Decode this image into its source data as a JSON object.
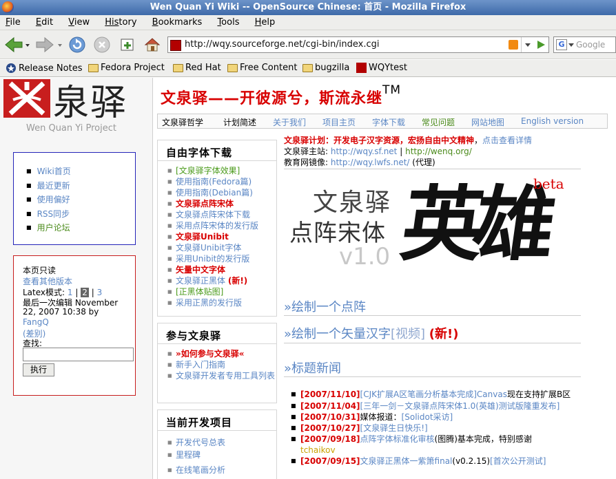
{
  "window": {
    "title": "Wen Quan Yi Wiki -- OpenSource Chinese: 首页 - Mozilla Firefox"
  },
  "menu": [
    {
      "key": "F",
      "rest": "ile"
    },
    {
      "key": "E",
      "rest": "dit"
    },
    {
      "key": "V",
      "rest": "iew"
    },
    {
      "key": "His",
      "rest": "tory"
    },
    {
      "key": "B",
      "rest": "ookmarks"
    },
    {
      "key": "T",
      "rest": "ools"
    },
    {
      "key": "H",
      "rest": "elp"
    }
  ],
  "nav": {
    "url": "http://wqy.sourceforge.net/cgi-bin/index.cgi",
    "search_placeholder": "Google",
    "search_engine_glyph": "G"
  },
  "bookmarks": [
    "Release Notes",
    "Fedora Project",
    "Red Hat",
    "Free Content",
    "bugzilla",
    "WQYtest"
  ],
  "logo": {
    "text": "泉驿",
    "subtitle": "Wen Quan Yi Project"
  },
  "sidebar_nav": [
    "Wiki首页",
    "最近更新",
    "使用偏好",
    "RSS同步",
    "用户论坛"
  ],
  "toolbox": {
    "this_page": "本页只读",
    "other_versions": "查看其他版本",
    "latex_label": "Latex模式:",
    "latex_1": "1",
    "latex_sep1": "|",
    "latex_2": "2",
    "latex_sep2": "|",
    "latex_3": "3",
    "last_edit_1": "最后一次编辑 November",
    "last_edit_2": "22, 2007 10:38 by",
    "author": "FangQ",
    "diff": "(差别)",
    "search_label": "查找:",
    "search_button": "执行"
  },
  "header": {
    "title": "文泉驿——开彼源兮，斯流永继",
    "tm": "TM"
  },
  "tabs": [
    "文泉驿哲学",
    "计划简述",
    "关于我们",
    "项目主页",
    "字体下载",
    "常见问题",
    "网站地图",
    "English version"
  ],
  "panels": {
    "fonts": {
      "title": "自由字体下载",
      "items": [
        {
          "text": "[文泉驿字体效果]",
          "style": "green"
        },
        {
          "text": "使用指南(Fedora篇)",
          "style": "link"
        },
        {
          "text": "使用指南(Debian篇)",
          "style": "link"
        },
        {
          "text": "文泉驿点阵宋体",
          "style": "red"
        },
        {
          "text": "文泉驿点阵宋体下载",
          "style": "link"
        },
        {
          "text": "采用点阵宋体的发行版",
          "style": "link"
        },
        {
          "text": "文泉驿Unibit",
          "style": "red"
        },
        {
          "text": "文泉驿Unibit字体",
          "style": "link"
        },
        {
          "text": "采用Unibit的发行版",
          "style": "link"
        },
        {
          "text": "矢量中文字体",
          "style": "red"
        },
        {
          "text": "文泉驿正黑体",
          "style": "link"
        },
        {
          "text": "(新!)",
          "style": "red"
        },
        {
          "text": "[正黑体贴图]",
          "style": "green"
        },
        {
          "text": "采用正黑的发行版",
          "style": "link"
        }
      ]
    },
    "join": {
      "title": "参与文泉驿",
      "items": [
        {
          "text": "»如何参与文泉驿«",
          "style": "red"
        },
        {
          "text": "新手入门指南",
          "style": "link"
        },
        {
          "text": "文泉驿开发者专用工具列表",
          "style": "link"
        }
      ]
    },
    "projects": {
      "title": "当前开发项目",
      "items": [
        {
          "text": "开发代号总表",
          "style": "link"
        },
        {
          "text": "里程碑",
          "style": "link"
        },
        {
          "text": "在线笔画分析",
          "style": "link"
        }
      ]
    }
  },
  "main": {
    "plan_label": "文泉驿计划：开发电子汉字资源，宏扬自由中文精神",
    "plan_sep": "，",
    "plan_link": "点击查看详情",
    "site_label": "文泉驿主站:",
    "site_1": "http://wqy.sf.net",
    "site_sep": "|",
    "site_2": "http://wenq.org/",
    "mirror_label": "教育网镜像:",
    "mirror": "http://wqy.lwfs.net/",
    "mirror_note": "(代理)",
    "banner": {
      "line1": "文泉驿",
      "line2": "点阵宋体",
      "version": "v1.0",
      "script": "英雄",
      "beta": "beta"
    },
    "h1": "»绘制一个点阵",
    "h2": "»绘制一个矢量汉字",
    "h2_link": "[视频]",
    "h2_new": "(新!)",
    "h3_arrow": "»",
    "h3": "标题新闻",
    "news": [
      {
        "date": "[2007/11/10]",
        "parts": [
          [
            "link",
            "[CJK扩展A区笔画分析基本完成]"
          ],
          [
            "link",
            "Canvas"
          ],
          [
            "plain",
            "现在支持扩展B区"
          ]
        ]
      },
      {
        "date": "[2007/11/04]",
        "parts": [
          [
            "link",
            "[三年一剑－文泉驿点阵宋体1.0(英雄)测试版隆重发布]"
          ]
        ]
      },
      {
        "date": "[2007/10/31]",
        "parts": [
          [
            "plain",
            "媒体报道："
          ],
          [
            "link",
            "[Solidot采访]"
          ]
        ]
      },
      {
        "date": "[2007/10/27]",
        "parts": [
          [
            "link",
            "[文泉驿生日快乐!]"
          ]
        ]
      },
      {
        "date": "[2007/09/18]",
        "parts": [
          [
            "link",
            "点阵字体标准化审核"
          ],
          [
            "plain",
            "(图腾)基本完成，特别感谢"
          ],
          [
            "link",
            "tchaikov"
          ]
        ]
      },
      {
        "date": "[2007/09/15]",
        "parts": [
          [
            "link",
            "文泉驿正黑体一紫箫final"
          ],
          [
            "plain",
            "(v0.2.15)"
          ],
          [
            "link",
            "[首次公开测试]"
          ]
        ]
      }
    ]
  }
}
